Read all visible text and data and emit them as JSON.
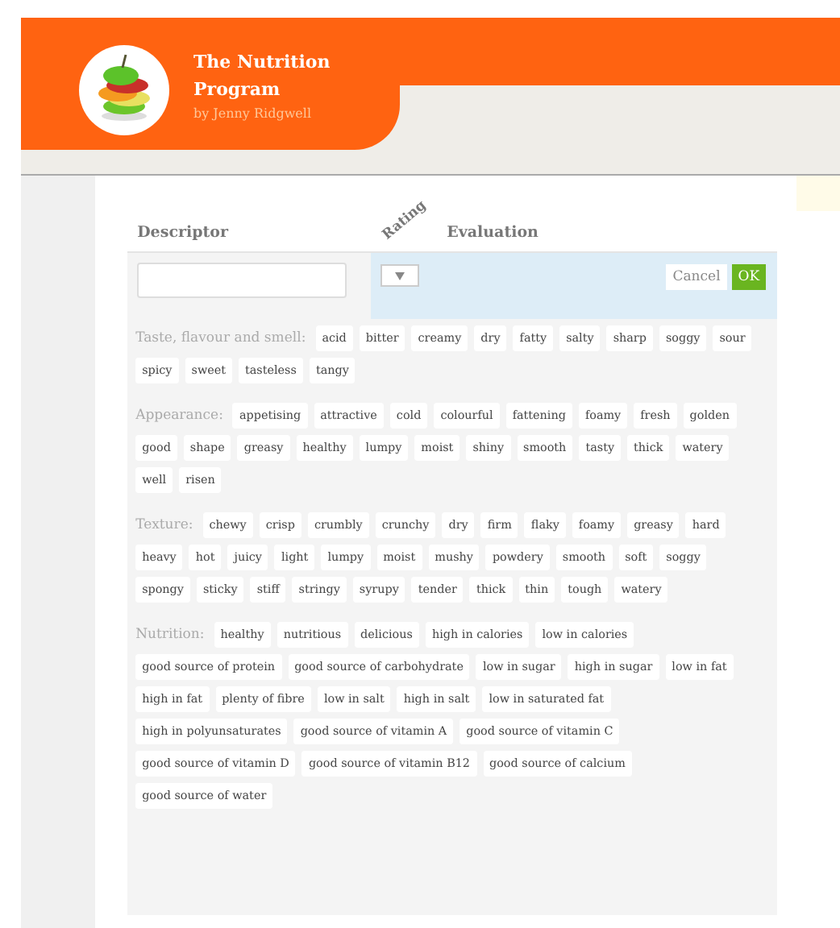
{
  "header": {
    "title": "The Nutrition Program",
    "subtitle": "by Jenny Ridgwell"
  },
  "columns": {
    "descriptor": "Descriptor",
    "rating": "Rating",
    "evaluation": "Evaluation"
  },
  "buttons": {
    "cancel": "Cancel",
    "ok": "OK"
  },
  "categories": [
    {
      "label": "Taste, flavour and smell:",
      "tags": [
        "acid",
        "bitter",
        "creamy",
        "dry",
        "fatty",
        "salty",
        "sharp",
        "soggy",
        "sour",
        "spicy",
        "sweet",
        "tasteless",
        "tangy"
      ]
    },
    {
      "label": "Appearance:",
      "tags": [
        "appetising",
        "attractive",
        "cold",
        "colourful",
        "fattening",
        "foamy",
        "fresh",
        "golden",
        "good",
        "shape",
        "greasy",
        "healthy",
        "lumpy",
        "moist",
        "shiny",
        "smooth",
        "tasty",
        "thick",
        "watery",
        "well",
        "risen"
      ]
    },
    {
      "label": "Texture:",
      "tags": [
        "chewy",
        "crisp",
        "crumbly",
        "crunchy",
        "dry",
        "firm",
        "flaky",
        "foamy",
        "greasy",
        "hard",
        "heavy",
        "hot",
        "juicy",
        "light",
        "lumpy",
        "moist",
        "mushy",
        "powdery",
        "smooth",
        "soft",
        "soggy",
        "spongy",
        "sticky",
        "stiff",
        "stringy",
        "syrupy",
        "tender",
        "thick",
        "thin",
        "tough",
        "watery"
      ]
    },
    {
      "label": "Nutrition:",
      "tags": [
        "healthy",
        "nutritious",
        "delicious",
        "high in calories",
        "low in calories",
        "good source of protein",
        "good source of carbohydrate",
        "low in sugar",
        "high in sugar",
        "low in fat",
        "high in fat",
        "plenty of fibre",
        "low in salt",
        "high in salt",
        "low in saturated fat",
        "high in polyunsaturates",
        "good source of vitamin A",
        "good source of vitamin C",
        "good source of vitamin D",
        "good source of vitamin B12",
        "good source of calcium",
        "good source of water"
      ]
    }
  ]
}
